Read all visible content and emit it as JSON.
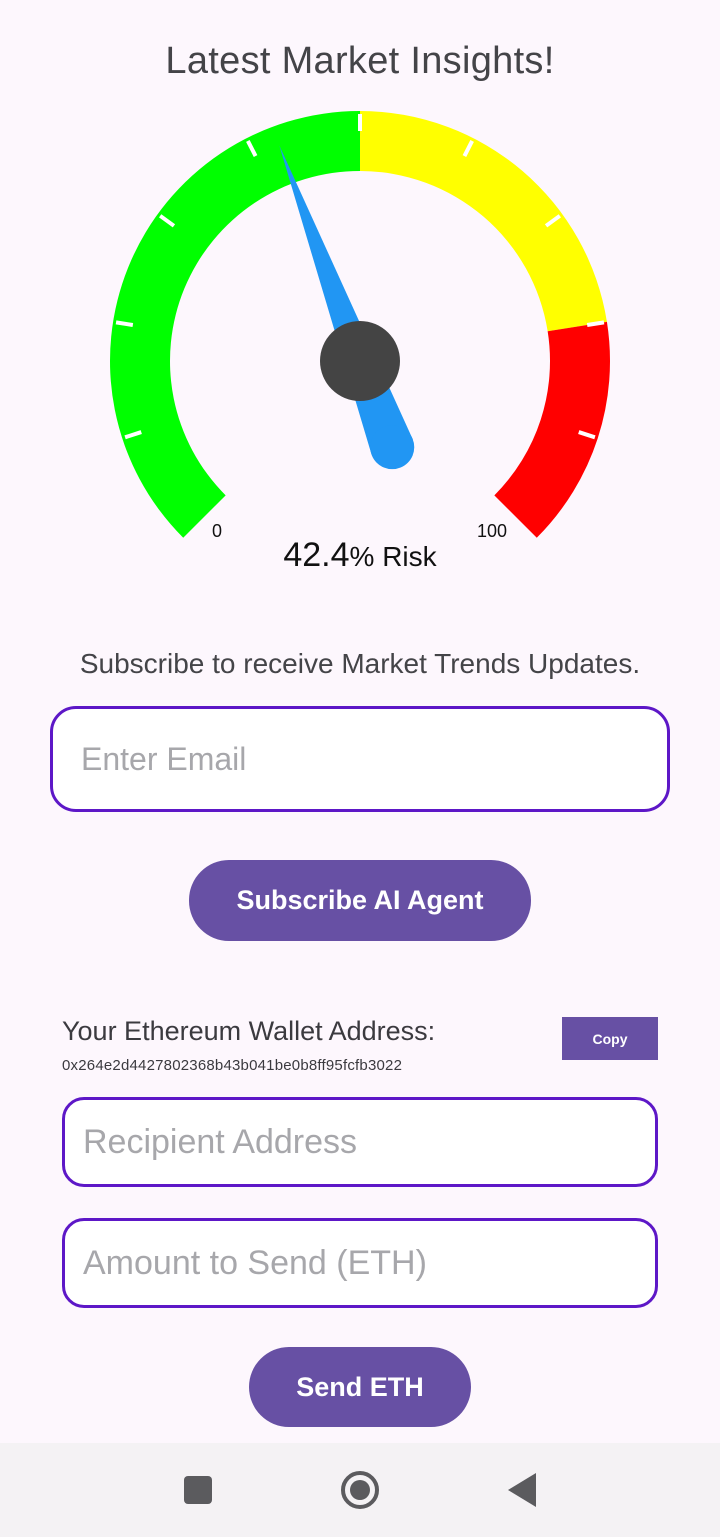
{
  "header": {
    "title": "Latest Market Insights!"
  },
  "gauge": {
    "min_label": "0",
    "max_label": "100",
    "value": 42.4,
    "value_text": "42.4",
    "unit_text": "% Risk",
    "zones": [
      {
        "from": 0,
        "to": 50,
        "color": "#00ff00"
      },
      {
        "from": 50,
        "to": 80,
        "color": "#ffff00"
      },
      {
        "from": 80,
        "to": 100,
        "color": "#ff0000"
      }
    ],
    "needle_color": "#2196f3",
    "hub_color": "#444444"
  },
  "subscribe": {
    "prompt": "Subscribe to receive Market Trends Updates.",
    "email_placeholder": "Enter Email",
    "button_label": "Subscribe AI Agent"
  },
  "wallet": {
    "label": "Your Ethereum Wallet Address:",
    "address": "0x264e2d4427802368b43b041be0b8ff95fcfb3022",
    "copy_label": "Copy",
    "recipient_placeholder": "Recipient Address",
    "amount_placeholder": "Amount to Send (ETH)",
    "send_label": "Send ETH"
  },
  "colors": {
    "accent": "#6750a4",
    "field_border": "#5d17c7",
    "background": "#fdf7fd"
  },
  "navbar": {
    "icons": [
      "recents-icon",
      "home-icon",
      "back-icon"
    ]
  }
}
